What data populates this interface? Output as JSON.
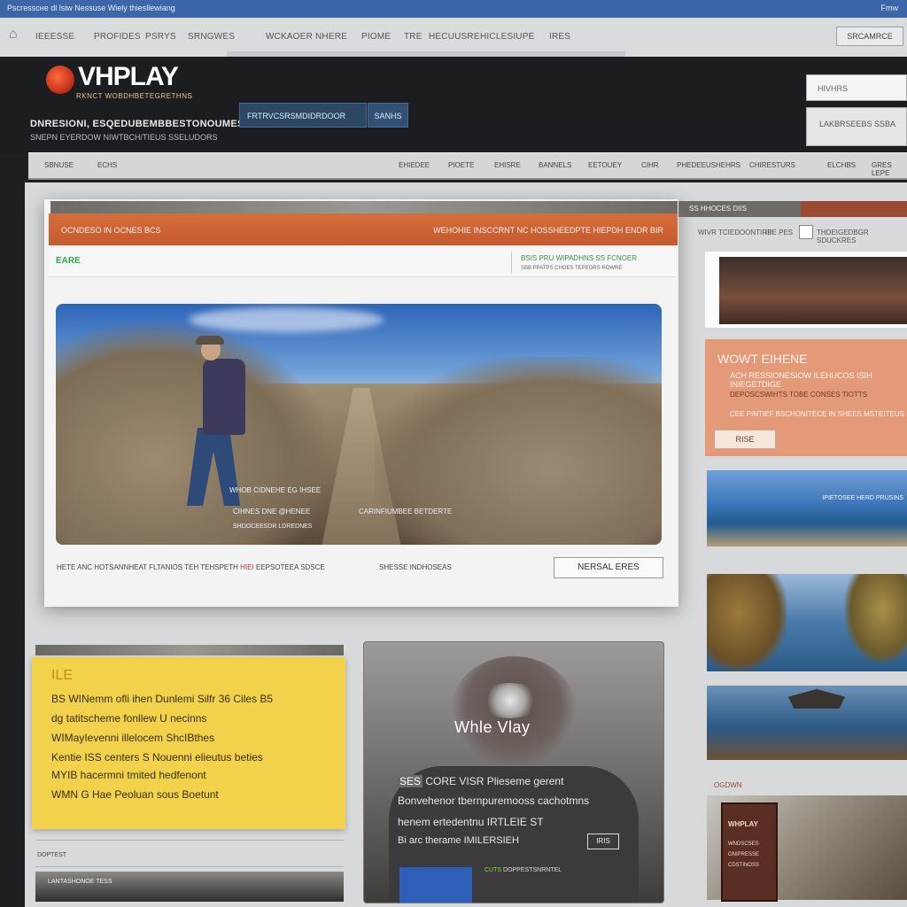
{
  "os_bar": {
    "left_text": "Рscгesscнe dl lsiw  Nessuse  Wiely thiesllewiang",
    "right_text": "Fmw"
  },
  "toolbar": {
    "nav": [
      "IEEESSE",
      "PROFIDES",
      "PSRYS",
      "SRNGWES",
      "WCKAOER",
      "NHERE",
      "PIOME",
      "TRE",
      "HECUUSRE",
      "HICLESIUPE",
      "IRES"
    ],
    "button_label": "SRCAMRCE"
  },
  "header": {
    "logo_text": "VHPLAY",
    "logo_sub": "RKNCT WOBDHBETEGRETHNS",
    "tagline_1": "DNRESIONI, ESQEDUBEMBBESTONOUMES",
    "tagline_2": "SNEPN EYERDOW NIWTBCH/TIEUS SSELUDORS",
    "search_placeholder": "FRTRVCSRSMDIDRDOOR",
    "search_button": "SANHS",
    "right_field": "HIVHRS",
    "right_box": "LAKBRSEEBS   SSBA"
  },
  "nav": [
    "SBNUSE",
    "ECHS",
    "EHIEDEE",
    "PIOETE",
    "EHISRE",
    "BANNELS",
    "EETOUEY",
    "CIHR",
    "PHEDEEUSHEHRS",
    "CHIRESTURS",
    "ELCHBS",
    "GRES LEPE"
  ],
  "main": {
    "orange_left": "OCNDESO IN OCNES BCS",
    "orange_right": "WEHOHIE INSCCRNT NC  HOSSHEEDPTE   HIEPDH ENDR   BIR",
    "badge": "EARE",
    "meta_line1": "BSIS  PRU WIPADHNS  SS FCNOER",
    "meta_line2": "SBB PPATPS CHOES TEPEORS ROWRE",
    "hero_caption_1": "WHOB CIDNEHE EG IHSEE",
    "hero_caption_2": "CIHNES DNE   @HENEE",
    "hero_caption_3": "SHDOCEESDR LDREDNES",
    "hero_caption_4": "CARINFIUMBEE BETDERTE",
    "footer_left": "HETE ANC HOTSANNHEAT FLTANIOS TEH TEHSPETH",
    "footer_red": "HIEI",
    "footer_mid": "EEPSOTEEA SDSCE",
    "footer_right": "SHESSE  INDHOSEAS",
    "read_more": "NERSAL ERES"
  },
  "sidebar": {
    "head_title": "SS HHOCES DIIS",
    "sub_left": "WIVR  TCIEDOONTIRS",
    "sub_mid": "IPE PES",
    "sub_right": "THDEIGEDBGR  SDUCKRES",
    "promo_title": "WOWT EIHENE",
    "promo_a": "ACH RESSIONESIOW  ILEHUCOS ISIH INIEGETDIGE",
    "promo_b": "DEPOSCSWIHTS TOBE CONSES TIOTTS",
    "promo_c": "CEE PINTIEF BSCHONITECE IN SHEES MSTEITEUS",
    "promo_button": "RISE",
    "img2_caption": "IPIETOSEE HERD PRUSINS",
    "img5_label": "OGDWN",
    "sign_title": "WHPLAY",
    "sign_l1": "WNDSCSES",
    "sign_l2": "ONIPRESSE",
    "sign_l3": "CDSTINOSS"
  },
  "yellow_card": {
    "kicker": "ILE",
    "lines": [
      "BS WINemm ofli ihen Dunlemi Silfr 36 Ciles B5",
      "dg tatitscheme fonllew U necinns",
      "WIMayIevenni illelocem ShcIBthes",
      "Kentie ISS centers S Nouenni elieutus beties",
      "MYIB hacermni tmited hedfenont",
      "WMN G Hae Peoluan sous Boetunt"
    ]
  },
  "bottom_left": {
    "label": "DOPTEST",
    "strip_text": "LANTASHONOE TESS"
  },
  "video_card": {
    "title": "Whle   Vlay",
    "l1_tag": "SES",
    "l1": "CORE VISR Plieseme gerent",
    "l2": "Bonvehenor tbernpuremooss cachotmns",
    "l3": "henem ertedentnu  IRTLEIE  ST",
    "l4": "Bi arc therame IMILERSIEH",
    "button": "IRIS",
    "foot_text_green": "CUTS",
    "foot_text": "DOPPESTSNRNTEL"
  }
}
